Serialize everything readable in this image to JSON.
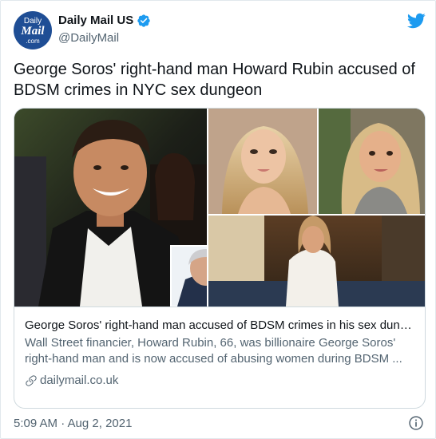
{
  "account": {
    "avatar_top": "Daily",
    "avatar_main": "Mail",
    "avatar_bottom": ".com",
    "display_name": "Daily Mail US",
    "handle": "@DailyMail"
  },
  "tweet": {
    "text": "George Soros' right-hand man Howard Rubin accused of BDSM crimes in NYC sex dungeon",
    "timestamp": "5:09 AM · Aug 2, 2021"
  },
  "card": {
    "title": "George Soros' right-hand man accused of BDSM crimes in his sex dunge...",
    "description_line1": "Wall Street financier, Howard Rubin, 66, was billionaire George Soros'",
    "description_line2": "right-hand man and is now accused of abusing women during BDSM ...",
    "domain": "dailymail.co.uk"
  },
  "icons": {
    "verified": "verified-badge-icon",
    "bird": "twitter-bird-icon",
    "link": "link-icon",
    "info": "info-icon"
  },
  "colors": {
    "twitter_blue": "#1d9bf0",
    "brand_navy": "#1f4e95",
    "secondary_text": "#536471",
    "border": "#cfd9de"
  }
}
